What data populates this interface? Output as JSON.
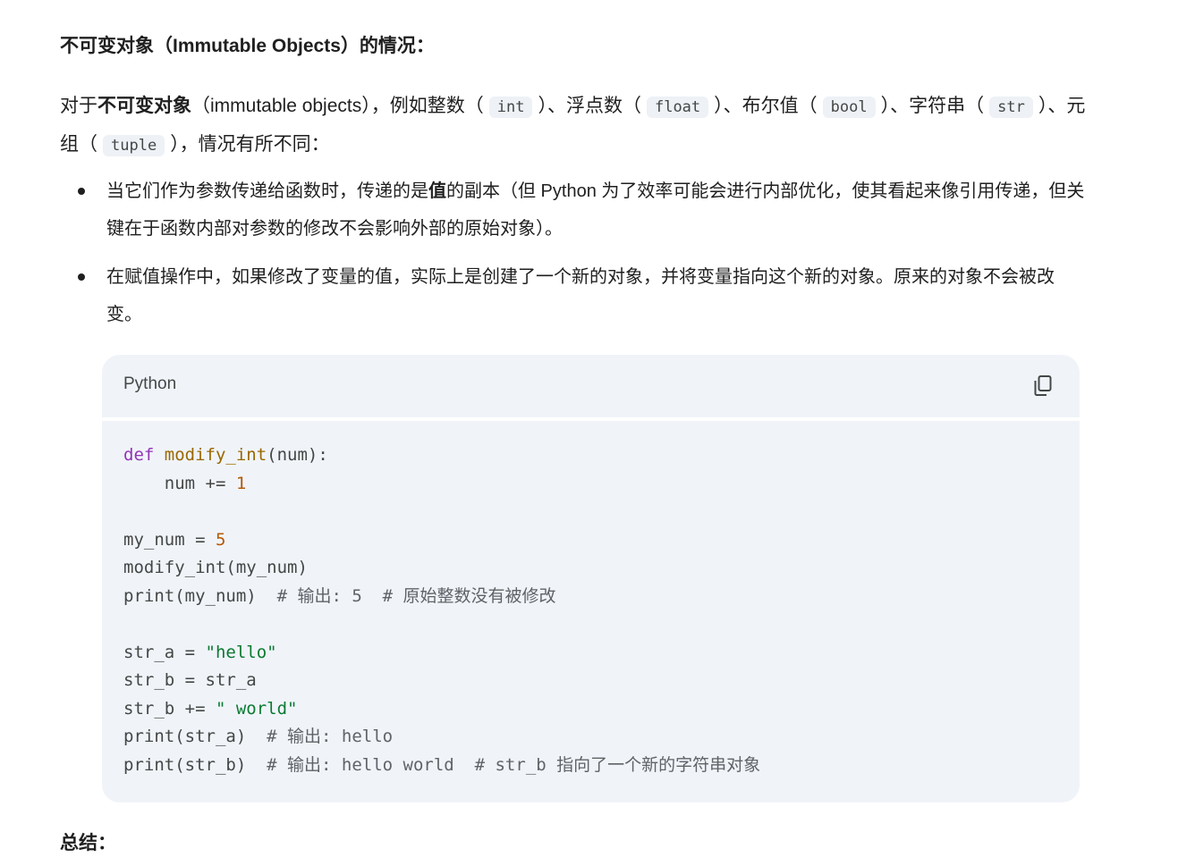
{
  "heading": "不可变对象（Immutable Objects）的情况：",
  "intro": {
    "p1": "对于",
    "bold": "不可变对象",
    "p2": "（immutable objects），例如整数（",
    "code_int": "int",
    "p3": "）、浮点数（",
    "code_float": "float",
    "p4": "）、布尔值（",
    "code_bool": "bool",
    "p5": "）、字符串（",
    "code_str": "str",
    "p6": "）、元组（",
    "code_tuple": "tuple",
    "p7": "），情况有所不同："
  },
  "bullets": [
    {
      "before": "当它们作为参数传递给函数时，传递的是",
      "bold": "值",
      "after": "的副本（但 Python 为了效率可能会进行内部优化，使其看起来像引用传递，但关键在于函数内部对参数的修改不会影响外部的原始对象）。"
    },
    {
      "text": "在赋值操作中，如果修改了变量的值，实际上是创建了一个新的对象，并将变量指向这个新的对象。原来的对象不会被改变。"
    }
  ],
  "code_block": {
    "language": "Python",
    "copy_icon": "copy-icon",
    "lines": [
      "def modify_int(num):",
      "    num += 1",
      "",
      "my_num = 5",
      "modify_int(my_num)",
      "print(my_num)  # 输出: 5  # 原始整数没有被修改",
      "",
      "str_a = \"hello\"",
      "str_b = str_a",
      "str_b += \" world\"",
      "print(str_a)  # 输出: hello",
      "print(str_b)  # 输出: hello world  # str_b 指向了一个新的字符串对象"
    ]
  },
  "summary": "总结：",
  "colors": {
    "keyword": "#9334b6",
    "function": "#9a6700",
    "number": "#b55908",
    "string": "#0b7a32",
    "comment": "#5f6368",
    "code_bg": "#f0f4f9"
  }
}
